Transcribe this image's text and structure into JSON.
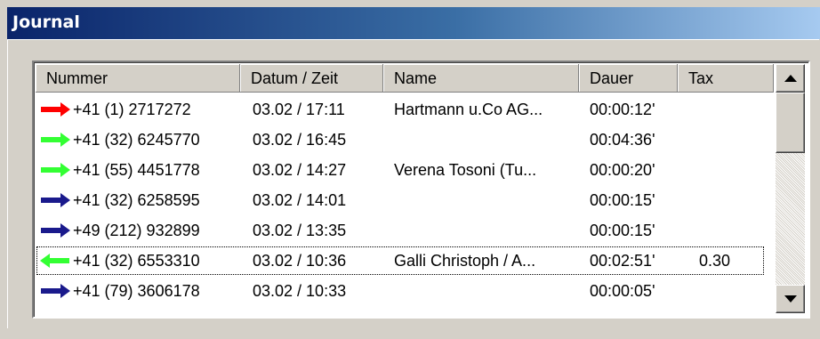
{
  "window": {
    "title": "Journal"
  },
  "columns": [
    {
      "label": "Nummer"
    },
    {
      "label": "Datum / Zeit"
    },
    {
      "label": "Name"
    },
    {
      "label": "Dauer"
    },
    {
      "label": "Tax"
    }
  ],
  "rows": [
    {
      "direction": "outgoing-red",
      "arrow_color": "#ff0000",
      "arrow_dir": "right",
      "nummer": "+41 (1) 2717272",
      "datum": "03.02 / 17:11",
      "name": "Hartmann u.Co AG...",
      "dauer": "00:00:12'",
      "tax": ""
    },
    {
      "direction": "incoming-answered",
      "arrow_color": "#33ff33",
      "arrow_dir": "right",
      "nummer": "+41 (32) 6245770",
      "datum": "03.02 / 16:45",
      "name": "",
      "dauer": "00:04:36'",
      "tax": ""
    },
    {
      "direction": "incoming-answered",
      "arrow_color": "#33ff33",
      "arrow_dir": "right",
      "nummer": "+41 (55) 4451778",
      "datum": "03.02 / 14:27",
      "name": "Verena Tosoni (Tu...",
      "dauer": "00:00:20'",
      "tax": ""
    },
    {
      "direction": "outgoing",
      "arrow_color": "#1a1a8c",
      "arrow_dir": "right",
      "nummer": "+41 (32) 6258595",
      "datum": "03.02 / 14:01",
      "name": "",
      "dauer": "00:00:15'",
      "tax": ""
    },
    {
      "direction": "outgoing",
      "arrow_color": "#1a1a8c",
      "arrow_dir": "right",
      "nummer": "+49 (212) 932899",
      "datum": "03.02 / 13:35",
      "name": "",
      "dauer": "00:00:15'",
      "tax": ""
    },
    {
      "direction": "incoming",
      "arrow_color": "#33ff33",
      "arrow_dir": "left",
      "nummer": "+41 (32) 6553310",
      "datum": "03.02 / 10:36",
      "name": "Galli Christoph / A...",
      "dauer": "00:02:51'",
      "tax": "0.30"
    },
    {
      "direction": "outgoing",
      "arrow_color": "#1a1a8c",
      "arrow_dir": "right",
      "nummer": "+41 (79) 3606178",
      "datum": "03.02 / 10:33",
      "name": "",
      "dauer": "00:00:05'",
      "tax": ""
    }
  ],
  "scrollbar": {
    "up_icon": "scroll-up-arrow-icon",
    "down_icon": "scroll-down-arrow-icon"
  }
}
